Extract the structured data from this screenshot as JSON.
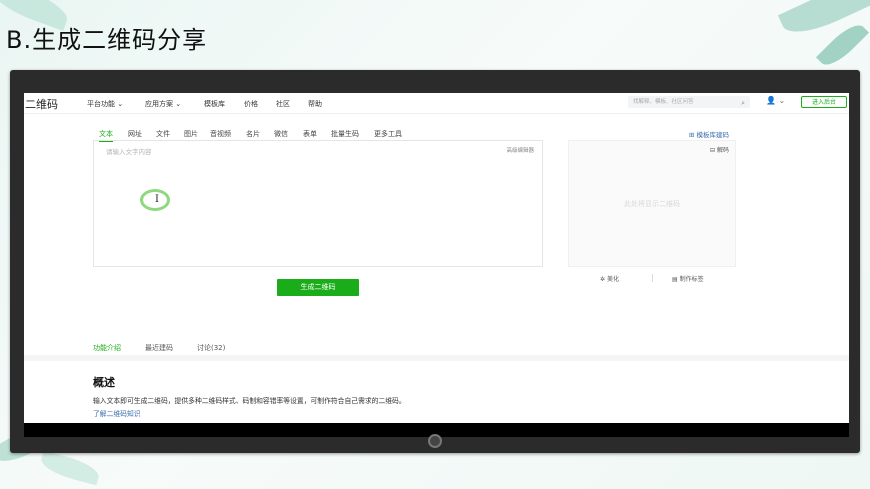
{
  "slide": {
    "title": "B.生成二维码分享"
  },
  "nav": {
    "logo": "二维码",
    "items": [
      "平台功能 ⌄",
      "应用方案 ⌄",
      "模板库",
      "价格",
      "社区",
      "帮助"
    ],
    "search_placeholder": "找解释、模板、社区问答",
    "login_label": "进入后台",
    "search_icon": "search-icon",
    "user_icon": "user-icon"
  },
  "tabs": [
    "文本",
    "网址",
    "文件",
    "图片",
    "音视频",
    "名片",
    "微信",
    "表单",
    "批量生码",
    "更多工具"
  ],
  "template_link": "模板库建码",
  "editor": {
    "placeholder": "请输入文字内容",
    "advanced": "高级编辑器",
    "cursor_glyph": "I"
  },
  "preview": {
    "decode_label": "解码",
    "hint": "此处将显示二维码"
  },
  "actions": {
    "beautify": "美化",
    "make_label": "制作标签"
  },
  "generate_button": "生成二维码",
  "bottom_tabs": [
    "功能介绍",
    "最近建码",
    "讨论(32)"
  ],
  "overview": {
    "heading": "概述",
    "text": "输入文本即可生成二维码，提供多种二维码样式、码制和容错率等设置，可制作符合自己需求的二维码。",
    "link": "了解二维码知识"
  },
  "colors": {
    "accent": "#1aad19",
    "link": "#3a6fb0"
  }
}
